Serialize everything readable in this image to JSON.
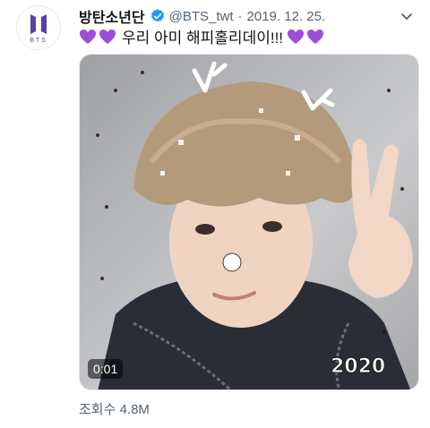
{
  "tweet": {
    "display_name": "방탄소년단",
    "handle": "@BTS_twt",
    "separator": "·",
    "date": "2019. 12. 25.",
    "text": "우리 아미 해피홀리데이!!!",
    "avatar_label": "BTS",
    "views": "조회수 4.8M"
  },
  "video": {
    "timestamp": "0:01"
  },
  "icons": {
    "verified": "verified-badge-icon",
    "heart": "purple-heart-emoji",
    "more": "chevron-down-icon"
  },
  "colors": {
    "verified": "#1d9bf0",
    "heart": "#9b4fd6",
    "secondary_text": "#536471"
  }
}
